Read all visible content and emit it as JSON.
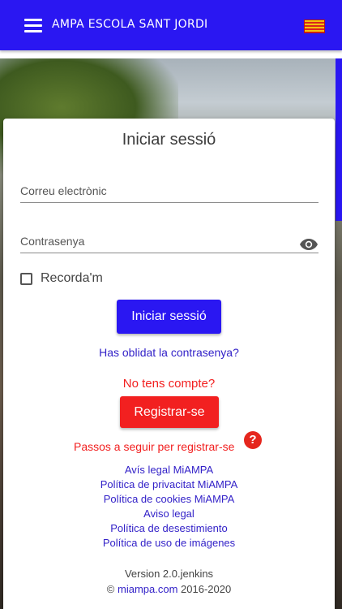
{
  "app": {
    "title": "AMPA ESCOLA SANT JORDI",
    "menu_icon": "menu-icon",
    "flag_icon": "catalan-flag-icon"
  },
  "login": {
    "title": "Iniciar sessió",
    "email_placeholder": "Correu electrònic",
    "email_value": "",
    "password_placeholder": "Contrasenya",
    "password_value": "",
    "show_password_icon": "eye-icon",
    "remember_label": "Recorda'm",
    "remember_checked": false,
    "login_button": "Iniciar sessió",
    "forgot_link": "Has oblidat la contrasenya?"
  },
  "register": {
    "prompt": "No tens compte?",
    "button": "Registrar-se",
    "steps_link": "Passos a seguir per registrar-se",
    "help_icon": "question-icon",
    "help_symbol": "?"
  },
  "footer": {
    "links": [
      "Avís legal MiAMPA",
      "Política de privacitat MiAMPA",
      "Política de cookies MiAMPA",
      "Aviso legal",
      "Política de desestimiento",
      "Política de uso de imágenes"
    ],
    "version": "Version 2.0.jenkins",
    "copyright_symbol": "©",
    "site": "miampa.com",
    "years": "2016-2020"
  },
  "colors": {
    "primary": "#2a17f2",
    "danger": "#f22020",
    "link": "#3322c8"
  }
}
